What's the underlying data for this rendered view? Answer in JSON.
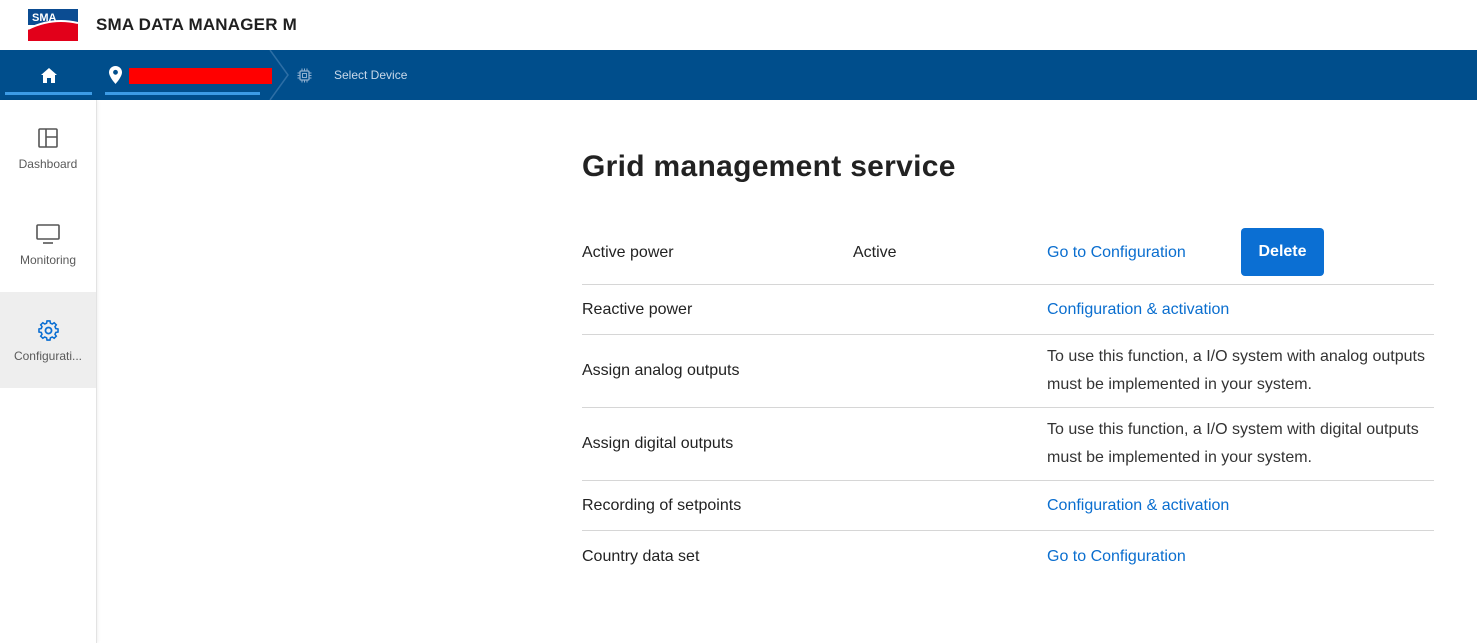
{
  "app": {
    "logo_text": "SMA",
    "title": "SMA DATA MANAGER M"
  },
  "nav": {
    "home_icon": "home-icon",
    "location_icon": "map-pin-icon",
    "device_icon": "chip-icon",
    "device_label": "Select Device"
  },
  "sidebar": {
    "items": [
      {
        "label": "Dashboard",
        "icon": "dashboard-icon"
      },
      {
        "label": "Monitoring",
        "icon": "monitor-icon"
      },
      {
        "label": "Configurati...",
        "icon": "gear-icon",
        "active": true
      }
    ]
  },
  "main": {
    "title": "Grid management service",
    "rows": [
      {
        "name": "Active power",
        "status": "Active",
        "action": "Go to Configuration",
        "button": "Delete"
      },
      {
        "name": "Reactive power",
        "status": "",
        "action": "Configuration & activation"
      },
      {
        "name": "Assign analog outputs",
        "status": "",
        "info": "To use this function, a I/O system with analog outputs must be implemented in your system."
      },
      {
        "name": "Assign digital outputs",
        "status": "",
        "info": "To use this function, a I/O system with digital outputs must be implemented in your system."
      },
      {
        "name": "Recording of setpoints",
        "status": "",
        "action": "Configuration & activation"
      },
      {
        "name": "Country data set",
        "status": "",
        "action": "Go to Configuration"
      }
    ]
  },
  "colors": {
    "navbar": "#004e8c",
    "accent": "#0b6fd3",
    "link": "#0a6ecf",
    "redacted": "#ff0000"
  }
}
